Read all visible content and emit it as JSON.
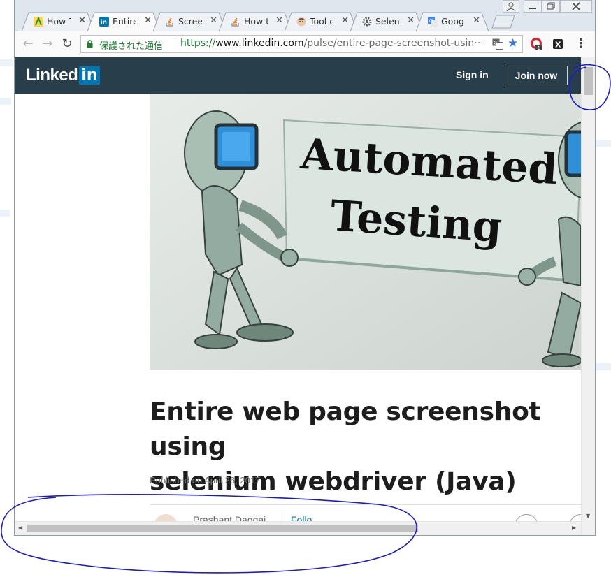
{
  "tabs": [
    {
      "title": "How T",
      "icon": "adsense-icon",
      "active": false
    },
    {
      "title": "Entire",
      "icon": "linkedin-icon",
      "active": true
    },
    {
      "title": "Scree",
      "icon": "stackoverflow-icon",
      "active": false
    },
    {
      "title": "How t",
      "icon": "stackoverflow-icon",
      "active": false
    },
    {
      "title": "Tool c",
      "icon": "avatar-icon",
      "active": false
    },
    {
      "title": "Selen",
      "icon": "gear-icon",
      "active": false
    },
    {
      "title": "Googl",
      "icon": "google-translate-icon",
      "active": false
    }
  ],
  "tab_close_glyph": "✕",
  "toolbar": {
    "back_glyph": "←",
    "forward_glyph": "→",
    "reload_glyph": "↻",
    "menu_glyph": "⋮"
  },
  "omnibox": {
    "security_label": "保護された通信",
    "url_scheme": "https://",
    "url_host": "www.linkedin.com",
    "url_path": "/pulse/entire-page-screenshot-usin···"
  },
  "extensions": [
    {
      "icon": "opera-extension-icon",
      "badge": "1"
    },
    {
      "icon": "x-extension-icon",
      "label": "X"
    }
  ],
  "linkedin": {
    "logo_text": "Linked",
    "logo_in": "in",
    "sign_in": "Sign in",
    "join_now": "Join now"
  },
  "article": {
    "hero_line1": "Automated",
    "hero_line2": "Testing",
    "title_line1": "Entire web page screenshot using",
    "title_line2": "selenium webdriver (Java)",
    "published": "Published on April 26, 2017",
    "author_partial": "Prashant Daggai",
    "follow_partial": "Follo"
  },
  "colors": {
    "linkedin_navy": "#283e4a",
    "linkedin_blue": "#0077b5",
    "secure_green": "#1a7f2e",
    "annotation_blue": "#1a1ad6"
  },
  "scroll": {
    "vertical_position_fraction": 0.0,
    "horizontal_position_fraction": 0.0
  }
}
